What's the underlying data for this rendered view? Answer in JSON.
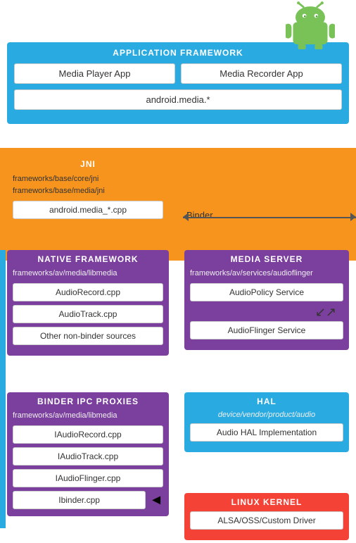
{
  "android": {
    "logo_color": "#78C257",
    "body_color": "#78C257"
  },
  "app_framework": {
    "title": "APPLICATION FRAMEWORK",
    "media_player": "Media Player App",
    "media_recorder": "Media Recorder App",
    "android_media": "android.media.*"
  },
  "jni": {
    "title": "JNI",
    "path1": "frameworks/base/core/jni",
    "path2": "frameworks/base/media/jni",
    "cpp": "android.media_*.cpp"
  },
  "binder": {
    "label": "Binder"
  },
  "native_framework": {
    "title": "NATIVE FRAMEWORK",
    "path": "frameworks/av/media/libmedia",
    "box1": "AudioRecord.cpp",
    "box2": "AudioTrack.cpp",
    "box3": "Other non-binder sources"
  },
  "media_server": {
    "title": "MEDIA SERVER",
    "path": "frameworks/av/services/audioflinger",
    "box1": "AudioPolicy Service",
    "box2": "AudioFlinger Service"
  },
  "binder_ipc": {
    "title": "BINDER IPC PROXIES",
    "path": "frameworks/av/media/libmedia",
    "box1": "IAudioRecord.cpp",
    "box2": "IAudioTrack.cpp",
    "box3": "IAudioFlinger.cpp",
    "box4": "Ibinder.cpp"
  },
  "hal": {
    "title": "HAL",
    "path": "device/vendor/product/audio",
    "box1": "Audio HAL Implementation"
  },
  "linux_kernel": {
    "title": "LINUX KERNEL",
    "box1": "ALSA/OSS/Custom Driver"
  }
}
